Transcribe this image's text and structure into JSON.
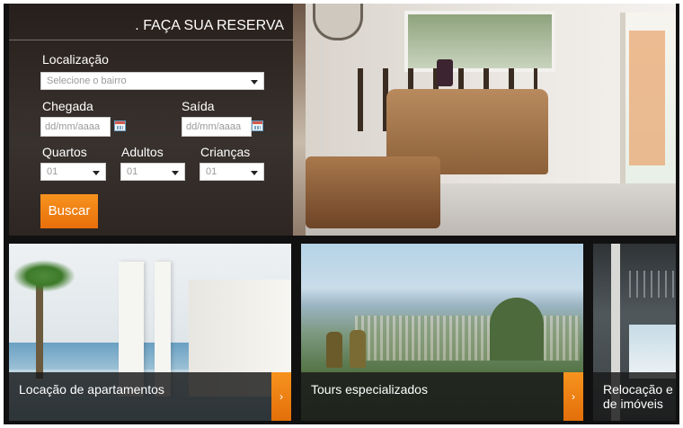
{
  "reservation": {
    "title": ". FAÇA SUA RESERVA",
    "location_label": "Localização",
    "location_placeholder": "Selecione o bairro",
    "checkin_label": "Chegada",
    "checkin_placeholder": "dd/mm/aaaa",
    "checkout_label": "Saída",
    "checkout_placeholder": "dd/mm/aaaa",
    "rooms_label": "Quartos",
    "rooms_value": "01",
    "adults_label": "Adultos",
    "adults_value": "01",
    "children_label": "Crianças",
    "children_value": "01",
    "search_button": "Buscar"
  },
  "cards": [
    {
      "label": "Locação de apartamentos",
      "arrow": "›"
    },
    {
      "label": "Tours especializados",
      "arrow": "›"
    },
    {
      "label_line1": "Relocação e",
      "label_line2": "de imóveis"
    }
  ],
  "colors": {
    "accent": "#f7931e",
    "panel": "#181412"
  }
}
